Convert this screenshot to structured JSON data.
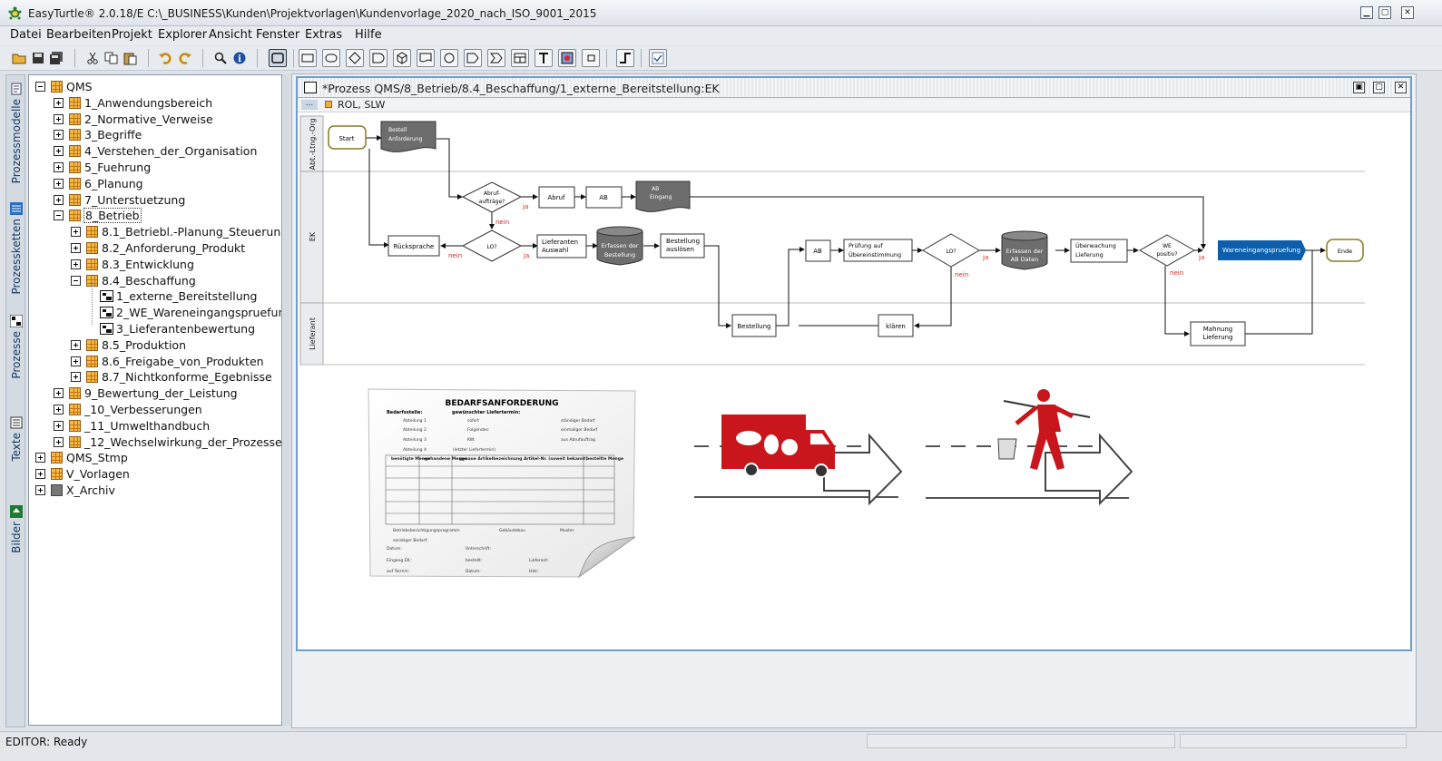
{
  "app": {
    "title": "EasyTurtle® 2.0.18/E C:\\_BUSINESS\\Kunden\\Projektvorlagen\\Kundenvorlage_2020_nach_ISO_9001_2015"
  },
  "menu": [
    "Datei",
    "Bearbeiten",
    "Projekt",
    "Explorer",
    "Ansicht",
    "Fenster",
    "Extras",
    "Hilfe"
  ],
  "side_tabs": [
    "Prozessmodelle",
    "Prozessketten",
    "Prozesse",
    "Texte",
    "Bilder"
  ],
  "tree": [
    {
      "label": "QMS",
      "level": 0,
      "exp": "minus",
      "icon": "folder"
    },
    {
      "label": "1_Anwendungsbereich",
      "level": 1,
      "exp": "plus",
      "icon": "folder"
    },
    {
      "label": "2_Normative_Verweise",
      "level": 1,
      "exp": "plus",
      "icon": "folder"
    },
    {
      "label": "3_Begriffe",
      "level": 1,
      "exp": "plus",
      "icon": "folder"
    },
    {
      "label": "4_Verstehen_der_Organisation",
      "level": 1,
      "exp": "plus",
      "icon": "folder"
    },
    {
      "label": "5_Fuehrung",
      "level": 1,
      "exp": "plus",
      "icon": "folder"
    },
    {
      "label": "6_Planung",
      "level": 1,
      "exp": "plus",
      "icon": "folder"
    },
    {
      "label": "7_Unterstuetzung",
      "level": 1,
      "exp": "plus",
      "icon": "folder"
    },
    {
      "label": "8_Betrieb",
      "level": 1,
      "exp": "minus",
      "icon": "folder",
      "sel": true
    },
    {
      "label": "8.1_Betriebl.-Planung_Steuerung",
      "level": 2,
      "exp": "plus",
      "icon": "folder"
    },
    {
      "label": "8.2_Anforderung_Produkt",
      "level": 2,
      "exp": "plus",
      "icon": "folder"
    },
    {
      "label": "8.3_Entwicklung",
      "level": 2,
      "exp": "plus",
      "icon": "folder"
    },
    {
      "label": "8.4_Beschaffung",
      "level": 2,
      "exp": "minus",
      "icon": "folder"
    },
    {
      "label": "1_externe_Bereitstellung",
      "level": 3,
      "exp": "none",
      "icon": "process"
    },
    {
      "label": "2_WE_Wareneingangspruefung",
      "level": 3,
      "exp": "none",
      "icon": "process"
    },
    {
      "label": "3_Lieferantenbewertung",
      "level": 3,
      "exp": "none",
      "icon": "process"
    },
    {
      "label": "8.5_Produktion",
      "level": 2,
      "exp": "plus",
      "icon": "folder"
    },
    {
      "label": "8.6_Freigabe_von_Produkten",
      "level": 2,
      "exp": "plus",
      "icon": "folder"
    },
    {
      "label": "8.7_Nichtkonforme_Egebnisse",
      "level": 2,
      "exp": "plus",
      "icon": "folder"
    },
    {
      "label": "9_Bewertung_der_Leistung",
      "level": 1,
      "exp": "plus",
      "icon": "folder"
    },
    {
      "label": "_10_Verbesserungen",
      "level": 1,
      "exp": "plus",
      "icon": "folder"
    },
    {
      "label": "_11_Umwelthandbuch",
      "level": 1,
      "exp": "plus",
      "icon": "folder"
    },
    {
      "label": "_12_Wechselwirkung_der_Prozesse",
      "level": 1,
      "exp": "plus",
      "icon": "folder"
    },
    {
      "label": "QMS_Stmp",
      "level": 0,
      "exp": "plus",
      "icon": "folder"
    },
    {
      "label": "V_Vorlagen",
      "level": 0,
      "exp": "plus",
      "icon": "folder"
    },
    {
      "label": "X_Archiv",
      "level": 0,
      "exp": "plus",
      "icon": "gray"
    }
  ],
  "doc": {
    "title": "*Prozess QMS/8_Betrieb/8.4_Beschaffung/1_externe_Bereitstellung:EK",
    "dots": "...",
    "roles": "ROL, SLW"
  },
  "diagram": {
    "lanes": [
      "Abt.-Ltng.-Org",
      "EK",
      "Lieferant"
    ],
    "start": "Start",
    "bestell": "Bestell Anforderung",
    "abrufq": "Abruf-aufträge?",
    "abruf": "Abruf",
    "ab1": "AB",
    "abeingang": "AB Eingang",
    "rueck": "Rücksprache",
    "lo1": "LO?",
    "liefausw": "Lieferanten Auswahl",
    "erf1": "Erfassen der Bestellung",
    "bestausl": "Bestellung auslösen",
    "ab2": "AB",
    "pruef": "Prüfung auf Übereinstimmung",
    "lo2": "LO?",
    "erf2": "Erfassen der AB Daten",
    "ueberw": "Überwachung Lieferung",
    "we": "WE positiv?",
    "wep": "Wareneingangspruefung",
    "ende": "Ende",
    "bestellung": "Bestellung",
    "klaeren": "klären",
    "mahnung": "Mahnung Lieferung",
    "ja": "ja",
    "nein": "nein"
  },
  "form": {
    "title": "BEDARFSANFORDERUNG",
    "bedarfsstelle": "Bedarfsstelle:",
    "liefertermin": "gewünschter Liefertermin:",
    "abt": [
      "Abteilung 1",
      "Abteilung 2",
      "Abteilung 3",
      "Abteilung 4"
    ],
    "opt1": [
      "sofort",
      "Folgendes:",
      "KW:",
      "(letzter Liefertermin)"
    ],
    "opt2": [
      "ständiger Bedarf",
      "einmaliger Bedarf",
      "aus Abrufauftrag"
    ],
    "col": [
      "benötigte Menge",
      "vorhandene Menge",
      "genaue Artikelbezeichnung Artikel-Nr. (soweit bekannt)",
      "bestellte Menge"
    ],
    "foot": [
      "Betriebsbesichtigungsprogramm",
      "Gebäudebau",
      "Muster",
      "sonstiger Bedarf:",
      "Datum:",
      "Unterschrift:",
      "Eingang EK:",
      "bestellt:",
      "Lieferant:",
      "auf Termin:",
      "Datum:",
      "Hdz:"
    ]
  },
  "status": "EDITOR: Ready",
  "colors": {
    "accent": "#0b5fad",
    "frame": "#6e9dd0",
    "nein": "#d9261c",
    "truck": "#c8161c"
  }
}
